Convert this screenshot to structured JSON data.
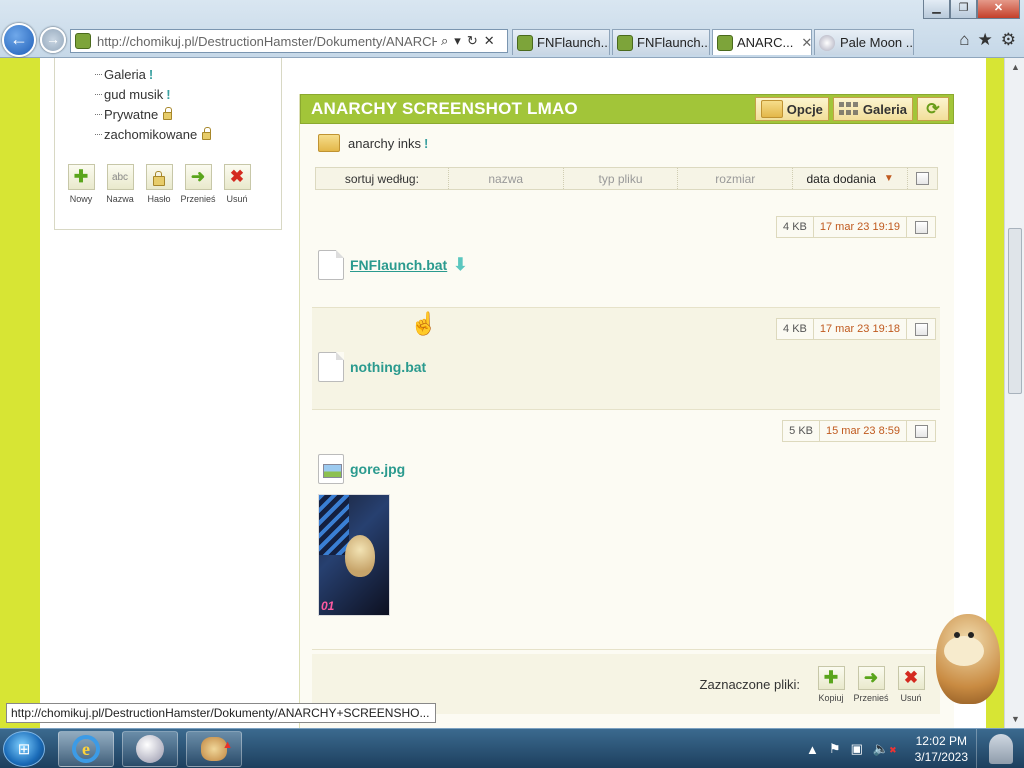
{
  "window": {
    "minimize": "▁",
    "maximize": "❐",
    "close": "✕"
  },
  "browser": {
    "url": "http://chomikuj.pl/DestructionHamster/Dokumenty/ANARCHY+SCREENSHOT",
    "address_icons": [
      "search-icon",
      "dropdown-icon",
      "refresh-icon",
      "stop-icon"
    ],
    "tabs": [
      {
        "label": "FNFlaunch....",
        "active": false
      },
      {
        "label": "FNFlaunch....",
        "active": false
      },
      {
        "label": "ANARC...",
        "active": true
      },
      {
        "label": "Pale Moon ...",
        "active": false
      }
    ],
    "right_icons": [
      "home-icon",
      "favorites-icon",
      "settings-icon"
    ]
  },
  "sidebar": {
    "tree": [
      {
        "label": "Galeria",
        "marker": "!"
      },
      {
        "label": "gud musik",
        "marker": "!"
      },
      {
        "label": "Prywatne",
        "marker": "lock"
      },
      {
        "label": "zachomikowane",
        "marker": "lock"
      }
    ],
    "actions": [
      {
        "label": "Nowy",
        "icon": "plus-icon",
        "glyph": "✚",
        "color": "#5aa51c"
      },
      {
        "label": "Nazwa",
        "icon": "rename-icon",
        "glyph": "abc",
        "color": "#777"
      },
      {
        "label": "Hasło",
        "icon": "lock-icon",
        "glyph": "🔒",
        "color": "#b08a2a"
      },
      {
        "label": "Przenieś",
        "icon": "move-arrow-icon",
        "glyph": "➜",
        "color": "#5aa51c"
      },
      {
        "label": "Usuń",
        "icon": "delete-icon",
        "glyph": "✖",
        "color": "#d42a1f"
      }
    ]
  },
  "panel": {
    "title": "ANARCHY SCREENSHOT LMAO",
    "options_label": "Opcje",
    "gallery_label": "Galeria",
    "subfolder": {
      "label": "anarchy inks",
      "marker": "!"
    },
    "sort": {
      "label": "sortuj według:",
      "columns": [
        "nazwa",
        "typ pliku",
        "rozmiar",
        "data dodania"
      ],
      "active_indicator": "▼"
    },
    "files": [
      {
        "name": "FNFlaunch.bat",
        "size": "4 KB",
        "date": "17 mar 23 19:19",
        "type": "doc",
        "hover": true
      },
      {
        "name": "nothing.bat",
        "size": "4 KB",
        "date": "17 mar 23 19:18",
        "type": "doc",
        "hover": false
      },
      {
        "name": "gore.jpg",
        "size": "5 KB",
        "date": "15 mar 23 8:59",
        "type": "image",
        "hover": false
      }
    ],
    "thumbnail_text": "01",
    "selected_label": "Zaznaczone pliki:",
    "selected_actions": [
      {
        "label": "Kopiuj",
        "icon": "copy-icon",
        "glyph": "✚",
        "color": "#5aa51c"
      },
      {
        "label": "Przenieś",
        "icon": "move-arrow-icon",
        "glyph": "➜",
        "color": "#5aa51c"
      },
      {
        "label": "Usuń",
        "icon": "delete-icon",
        "glyph": "✖",
        "color": "#d42a1f"
      }
    ]
  },
  "status_url": "http://chomikuj.pl/DestructionHamster/Dokumenty/ANARCHY+SCREENSHO...",
  "taskbar": {
    "time": "12:02 PM",
    "date": "3/17/2023",
    "apps": [
      "internet-explorer-icon",
      "pale-moon-icon",
      "hamster-app-icon"
    ],
    "tray_icons": [
      "show-hidden-icons-arrow",
      "action-center-flag-icon",
      "network-icon",
      "volume-muted-icon"
    ]
  },
  "colors": {
    "accent_green": "#a2c539",
    "page_lime": "#d7e534",
    "link_teal": "#2a9a8e",
    "date_orange": "#c05a1f"
  }
}
